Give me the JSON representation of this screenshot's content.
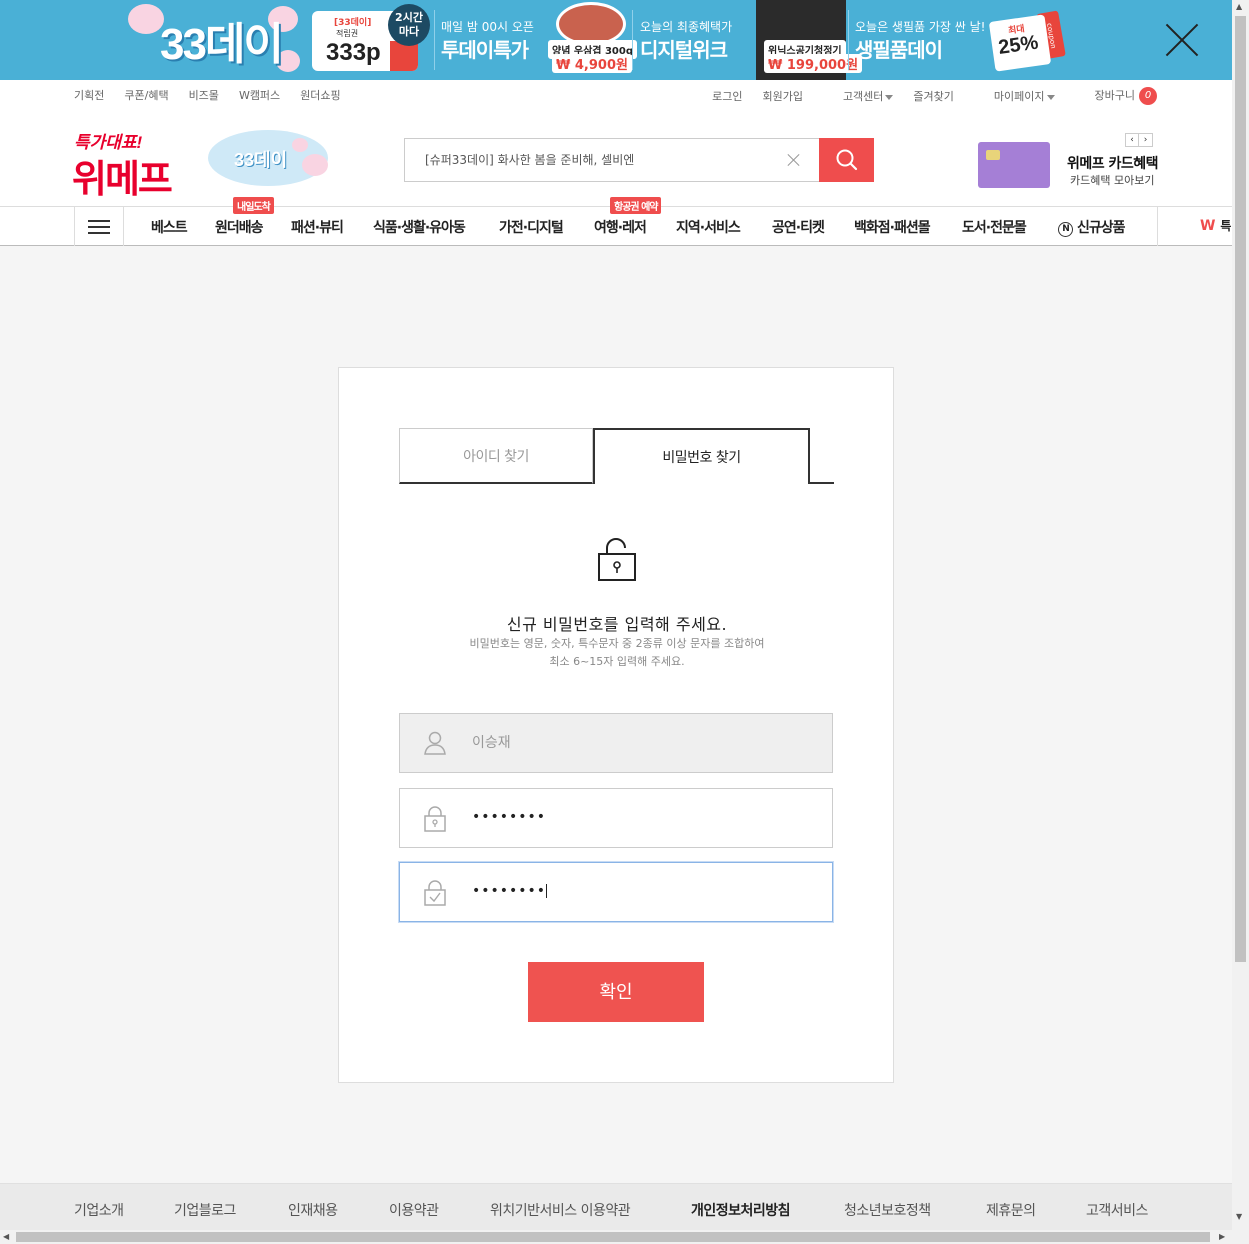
{
  "banner": {
    "logo": "33데이",
    "point_tag": "[33데이]",
    "point_sub": "적립권",
    "point_value": "333p",
    "circle": "2시간\n마다",
    "today_top": "매일 밤 00시 오픈",
    "today_title": "투데이특가",
    "today_item": "양념 우삼겹 300g",
    "today_price": "₩ 4,900원",
    "digital_top": "오늘의 최종혜택가",
    "digital_title": "디지털위크",
    "digital_item": "위닉스공기청정기",
    "digital_price": "₩ 199,000원",
    "daily_top": "오늘은 생필품 가장 싼 날!",
    "daily_title": "생필품데이",
    "coupon_top": "최대",
    "coupon_value": "25%",
    "coupon_side": "coupon"
  },
  "util_left": [
    "기획전",
    "쿠폰/혜택",
    "비즈몰",
    "W캠퍼스",
    "원더쇼핑"
  ],
  "util_right": {
    "login": "로그인",
    "join": "회원가입",
    "cs": "고객센터",
    "fav": "즐겨찾기",
    "mypage": "마이페이지",
    "cart": "장바구니",
    "cart_count": "0"
  },
  "logo": {
    "sub": "특가대표!",
    "main": "위메프"
  },
  "event_logo": "33데이",
  "search": {
    "value": "[슈퍼33데이] 화사한 봄을 준비해, 셀비엔"
  },
  "card": {
    "title": "위메프 카드혜택",
    "sub": "카드혜택 모아보기",
    "prev": "‹",
    "next": "›"
  },
  "gnb": {
    "items": [
      "베스트",
      "원더배송",
      "패션·뷰티",
      "식품·생활·유아동",
      "가전·디지털",
      "여행·레저",
      "지역·서비스",
      "공연·티켓",
      "백화점·패션몰",
      "도서·전문몰",
      "신규상품"
    ],
    "tag_wonder": "내일도착",
    "tag_travel": "항공권 예약",
    "n_badge": "N",
    "w_logo": "W",
    "w_text": "특"
  },
  "panel": {
    "tab_id": "아이디 찾기",
    "tab_pw": "비밀번호 찾기",
    "title": "신규 비밀번호를 입력해 주세요.",
    "desc1": "비밀번호는 영문, 숫자, 특수문자 중 2종류 이상 문자를 조합하여",
    "desc2": "최소 6~15자 입력해 주세요.",
    "name_value": "이승재",
    "pw1_value": "••••••••",
    "pw2_value": "••••••••",
    "confirm": "확인"
  },
  "footer": [
    "기업소개",
    "기업블로그",
    "인재채용",
    "이용약관",
    "위치기반서비스 이용약관",
    "개인정보처리방침",
    "청소년보호정책",
    "제휴문의",
    "고객서비스"
  ],
  "colors": {
    "brand": "#e8002d",
    "accent": "#ef4d4d",
    "banner": "#4ab0d6"
  }
}
